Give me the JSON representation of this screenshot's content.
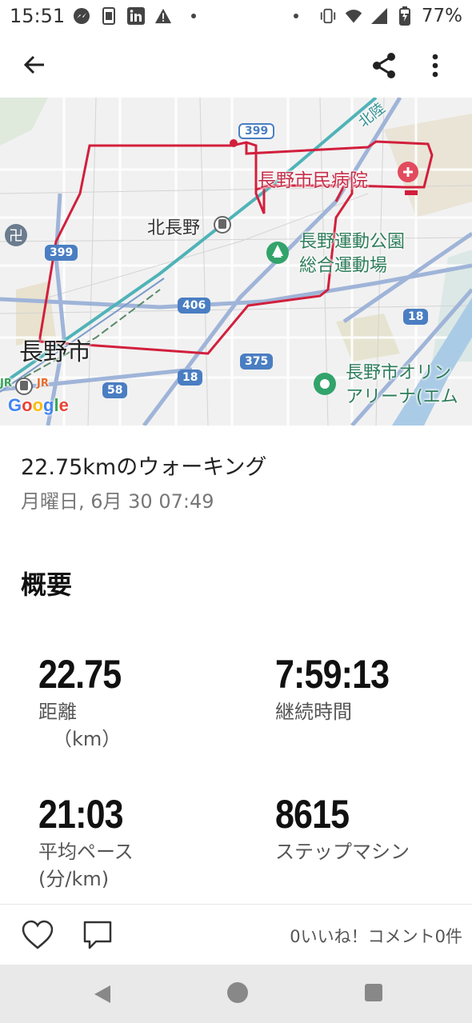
{
  "status_bar": {
    "time": "15:51",
    "battery": "77%",
    "icons": [
      "messenger-icon",
      "sim-icon",
      "linkedin-icon",
      "warning-icon",
      "dot",
      "dot",
      "vibrate-icon",
      "wifi-icon",
      "signal-icon",
      "battery-charging-icon"
    ]
  },
  "app_bar": {
    "icons": [
      "back-arrow-icon",
      "share-icon",
      "more-vert-icon"
    ]
  },
  "map": {
    "labels": {
      "hospital": "長野市民病院",
      "kita_nagano": "北長野",
      "park_line1": "長野運動公園",
      "park_line2": "総合運動場",
      "city": "長野市",
      "arena_line1": "長野市オリン",
      "arena_line2": "アリーナ(エム",
      "rail_top": "北陸",
      "jr": "JR"
    },
    "road_shields": [
      "399",
      "399",
      "406",
      "18",
      "375",
      "18",
      "58"
    ],
    "google": [
      "G",
      "o",
      "o",
      "g",
      "l",
      "e"
    ],
    "colors": {
      "route": "#d21f3c",
      "rail": "#4fb3b8",
      "road": "#8fa7cf",
      "background": "#f1f1f1"
    }
  },
  "activity": {
    "title": "22.75kmのウォーキング",
    "date": "月曜日, 6月 30 07:49"
  },
  "summary": {
    "title": "概要",
    "stats": [
      {
        "value": "22.75",
        "label": "距離",
        "unit": "（km）"
      },
      {
        "value": "7:59:13",
        "label": "継続時間",
        "unit": ""
      },
      {
        "value": "21:03",
        "label": "平均ペース",
        "unit": "(分/km)"
      },
      {
        "value": "8615",
        "label": "ステップマシン",
        "unit": ""
      }
    ]
  },
  "actions": {
    "counts_text": "0いいね！コメント0件",
    "icons": [
      "heart-icon",
      "comment-icon"
    ]
  },
  "nav_bar": {
    "icons": [
      "nav-back-icon",
      "nav-home-icon",
      "nav-recents-icon"
    ]
  }
}
